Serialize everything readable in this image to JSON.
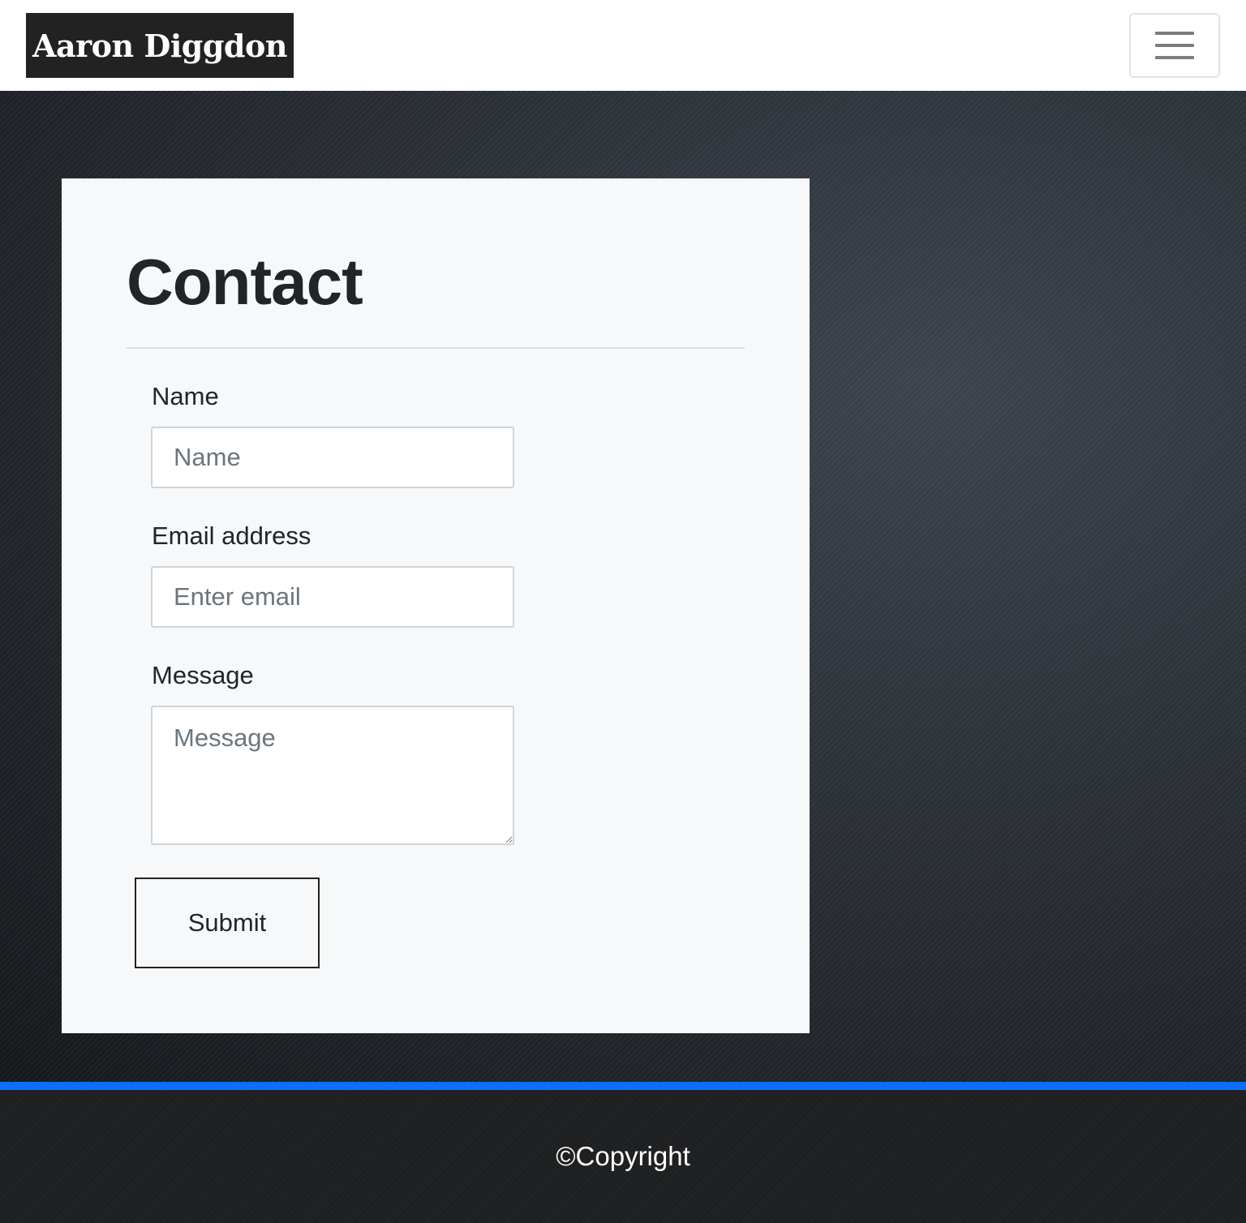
{
  "navbar": {
    "brand": "Aaron Diggdon",
    "toggle_icon": "hamburger-menu-icon"
  },
  "contact": {
    "title": "Contact",
    "name_label": "Name",
    "name_placeholder": "Name",
    "email_label": "Email address",
    "email_placeholder": "Enter email",
    "message_label": "Message",
    "message_placeholder": "Message",
    "submit_label": "Submit"
  },
  "footer": {
    "copyright": "©Copyright"
  },
  "colors": {
    "accent": "#0d6efd",
    "brand_bg": "#222222",
    "card_bg": "#f7f8fa",
    "footer_bg": "#1e1f21"
  }
}
